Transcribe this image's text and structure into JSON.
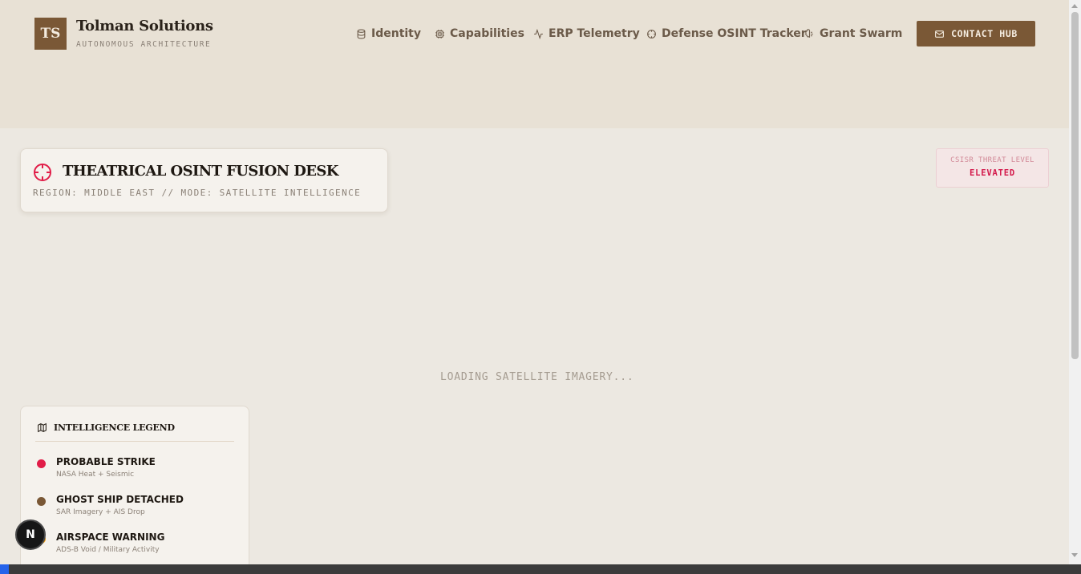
{
  "brand": {
    "logo_text": "TS",
    "title": "Tolman Solutions",
    "subtitle": "AUTONOMOUS ARCHITECTURE"
  },
  "nav": {
    "items": [
      {
        "label": "Identity",
        "icon": "database-icon"
      },
      {
        "label": "Capabilities",
        "icon": "cpu-icon"
      },
      {
        "label": "ERP Telemetry",
        "icon": "activity-icon"
      },
      {
        "label": "Defense OSINT Tracker",
        "icon": "crosshair-icon"
      },
      {
        "label": "Grant Swarm",
        "icon": "brain-icon"
      }
    ],
    "contact_label": "CONTACT HUB",
    "contact_icon": "mail-icon"
  },
  "fusion_desk": {
    "title": "THEATRICAL OSINT FUSION DESK",
    "subtitle": "REGION: MIDDLE EAST // MODE: SATELLITE INTELLIGENCE",
    "icon": "crosshair-icon"
  },
  "threat": {
    "label": "CSISR THREAT LEVEL",
    "value": "ELEVATED"
  },
  "map": {
    "loading_text": "LOADING SATELLITE IMAGERY..."
  },
  "legend": {
    "title": "INTELLIGENCE LEGEND",
    "icon": "map-icon",
    "items": [
      {
        "title": "PROBABLE STRIKE",
        "desc": "NASA Heat + Seismic",
        "color": "#e11d48"
      },
      {
        "title": "GHOST SHIP DETACHED",
        "desc": "SAR Imagery + AIS Drop",
        "color": "#7a5836"
      },
      {
        "title": "AIRSPACE WARNING",
        "desc": "ADS-B Void / Military Activity",
        "color": "#f59e0b"
      }
    ]
  },
  "badge": {
    "text": "N"
  },
  "colors": {
    "accent": "#7a5836",
    "alert": "#d3184a",
    "background": "#ece8e1"
  }
}
